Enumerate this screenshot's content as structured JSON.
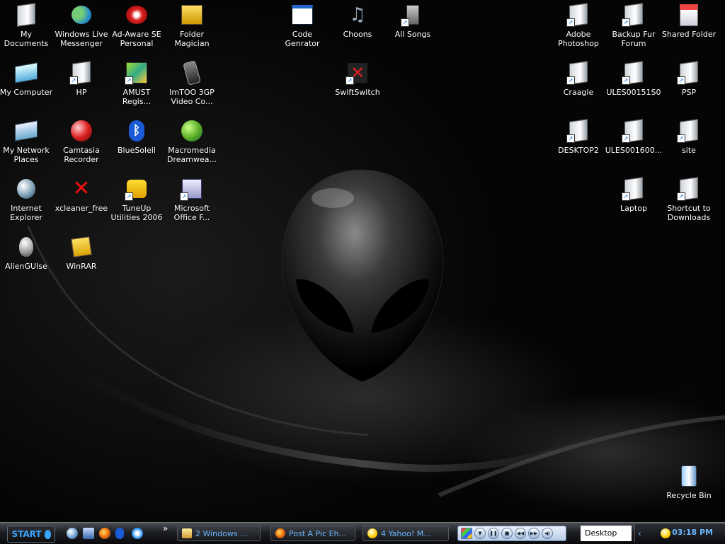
{
  "desktop_icons": {
    "my_documents": "My Documents",
    "windows_live_messenger": "Windows Live Messenger",
    "ad_aware": "Ad-Aware SE Personal",
    "folder_magician": "Folder Magician",
    "code_genrator": "Code Genrator",
    "choons": "Choons",
    "all_songs": "All Songs",
    "adobe_photoshop": "Adobe Photoshop",
    "backup_fur_forum": "Backup Fur Forum",
    "shared_folder": "Shared Folder",
    "my_computer": "My Computer",
    "hp": "HP",
    "amust": "AMUST Regis...",
    "imtoo": "ImTOO 3GP Video Co...",
    "swiftswitch": "SwiftSwitch",
    "craagle": "Craagle",
    "ules00151": "ULES00151S0",
    "psp": "PSP",
    "my_network_places": "My Network Places",
    "camtasia": "Camtasia Recorder",
    "bluesoleil": "BlueSoleil",
    "dreamweaver": "Macromedia Dreamwea...",
    "desktop2": "DESKTOP2",
    "ules001600": "ULES001600...",
    "site": "site",
    "internet_explorer": "Internet Explorer",
    "xcleaner": "xcleaner_free",
    "tuneup": "TuneUp Utilities 2006",
    "ms_office": "Microsoft Office F...",
    "laptop": "Laptop",
    "shortcut_downloads": "Shortcut to Downloads",
    "alienguise": "AlienGUIse",
    "winrar": "WinRAR",
    "recycle_bin": "Recycle Bin"
  },
  "taskbar": {
    "start_label": "START",
    "tasks": {
      "windows": "2 Windows ...",
      "post_pic": "Post A Pic Eh...",
      "yahoo": "4 Yahoo! M..."
    },
    "desktop_toolbar": "Desktop",
    "clock": "03:18 PM",
    "chevron": "»"
  },
  "colors": {
    "taskbar_text": "#6ab7ff",
    "start_text": "#37a6ff"
  }
}
